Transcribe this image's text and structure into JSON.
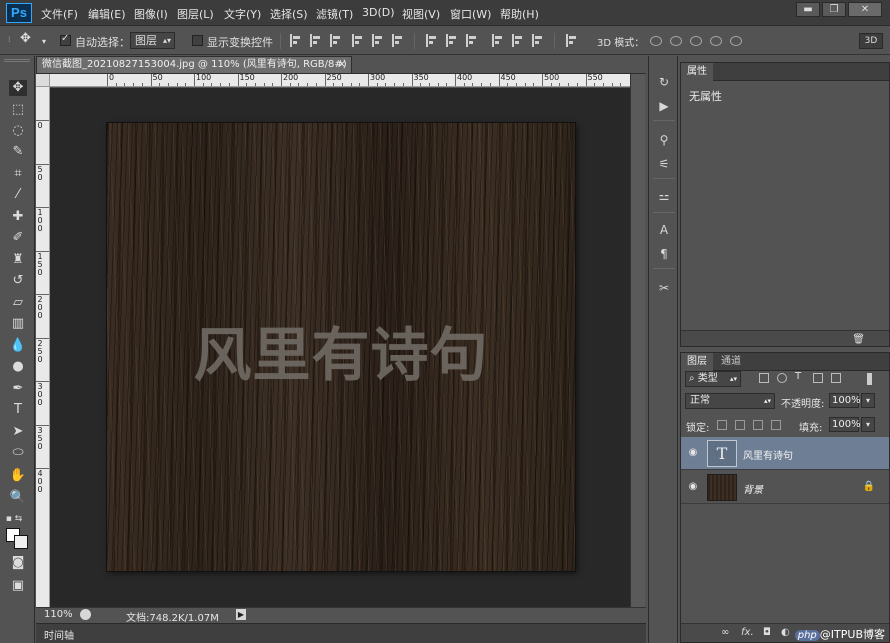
{
  "app": {
    "logo": "Ps"
  },
  "menu": [
    "文件(F)",
    "编辑(E)",
    "图像(I)",
    "图层(L)",
    "文字(Y)",
    "选择(S)",
    "滤镜(T)",
    "3D(D)",
    "视图(V)",
    "窗口(W)",
    "帮助(H)"
  ],
  "window_controls": {
    "minimize": "▬",
    "restore": "❐",
    "close": "✕"
  },
  "options": {
    "auto_select_label": "自动选择：",
    "auto_select_checked": true,
    "auto_select_target": "图层",
    "show_transform_label": "显示变换控件",
    "show_transform_checked": false,
    "mode3d_label": "3D 模式：",
    "btn3d": "3D"
  },
  "document": {
    "tab_title": "微信截图_20210827153004.jpg @ 110% (风里有诗句, RGB/8#) *",
    "tab_close": "×",
    "canvas_text": "风里有诗句",
    "zoom": "110%",
    "doc_info": "文档:748.2K/1.07M"
  },
  "ruler_h": [
    "0",
    "50",
    "100",
    "150",
    "200",
    "250",
    "300",
    "350",
    "400",
    "450",
    "500",
    "550"
  ],
  "ruler_v": [
    "0",
    "5\n0",
    "1\n0\n0",
    "1\n5\n0",
    "2\n0\n0",
    "2\n5\n0",
    "3\n0\n0",
    "3\n5\n0",
    "4\n0\n0"
  ],
  "timeline_label": "时间轴",
  "properties": {
    "tab": "属性",
    "content": "无属性"
  },
  "layers_panel": {
    "tabs": [
      "图层",
      "通道"
    ],
    "filter_kind": "类型",
    "blend_mode": "正常",
    "opacity_label": "不透明度:",
    "opacity": "100%",
    "lock_label": "锁定:",
    "fill_label": "填充:",
    "fill": "100%",
    "layers": [
      {
        "name": "风里有诗句",
        "thumb": "T",
        "selected": true
      },
      {
        "name": "背景",
        "locked": true,
        "selected": false
      }
    ],
    "footer_icons": [
      "link-icon",
      "fx-icon",
      "mask-icon",
      "adjustment-icon"
    ],
    "fx_label": "fx."
  },
  "watermark": {
    "logo": "php",
    "text": "@ITPUB博客"
  }
}
